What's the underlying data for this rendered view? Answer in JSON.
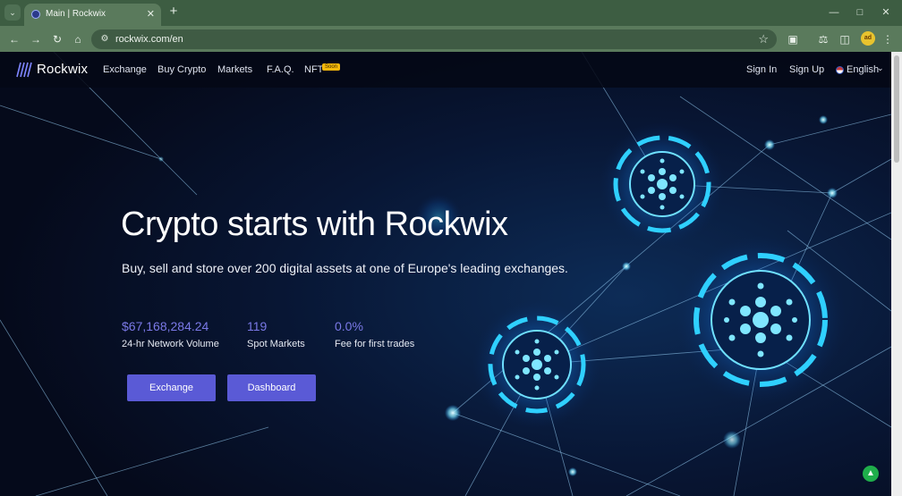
{
  "browser": {
    "tab_title": "Main | Rockwix",
    "url": "rockwix.com/en",
    "profile_initials": "ad"
  },
  "site": {
    "logo": "Rockwix",
    "nav": [
      "Exchange",
      "Buy Crypto",
      "Markets",
      "F.A.Q.",
      "NFT"
    ],
    "soon_badge": "Soon",
    "sign_in": "Sign In",
    "sign_up": "Sign Up",
    "language": "English"
  },
  "hero": {
    "title": "Crypto starts with Rockwix",
    "subtitle": "Buy, sell and store over 200 digital assets at one of Europe's leading exchanges.",
    "stats": [
      {
        "value": "$67,168,284.24",
        "label": "24-hr Network Volume"
      },
      {
        "value": "119",
        "label": "Spot Markets"
      },
      {
        "value": "0.0%",
        "label": "Fee for first trades"
      }
    ],
    "buttons": [
      "Exchange",
      "Dashboard"
    ]
  },
  "colors": {
    "accent": "#5a5ad6",
    "stat_value": "#7a79e6",
    "page_bg": "#060b1c",
    "chrome": "#5a7a5c",
    "badge": "#f5b70a"
  },
  "icons": [
    "search-tabs-icon",
    "close-icon",
    "plus-icon",
    "back-icon",
    "forward-icon",
    "reload-icon",
    "home-icon",
    "site-info-icon",
    "star-icon",
    "extensions-icon",
    "labs-icon",
    "sidebar-icon",
    "menu-icon",
    "help-icon"
  ]
}
